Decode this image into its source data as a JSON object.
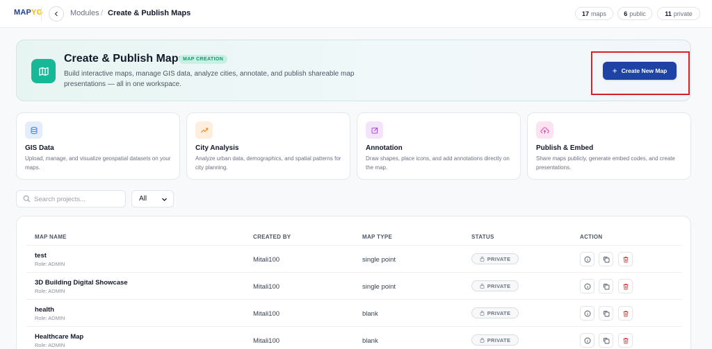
{
  "topbar": {
    "logo": "MAP",
    "logo_accent": "YG",
    "breadcrumb_root": "Modules",
    "breadcrumb_sep": "/",
    "breadcrumb_current": "Create & Publish Maps",
    "stats": [
      {
        "count": "17",
        "label": "maps"
      },
      {
        "count": "6",
        "label": "public"
      },
      {
        "count": "11",
        "label": "private"
      }
    ]
  },
  "hero": {
    "title": "Create & Publish Maps",
    "badge": "MAP CREATION",
    "description": "Build interactive maps, manage GIS data, analyze cities, annotate, and publish shareable map presentations — all in one workspace.",
    "create_button": "Create New Map"
  },
  "features": [
    {
      "title": "GIS Data",
      "desc": "Upload, manage, and visualize geospatial datasets on your maps.",
      "icon": "database-icon",
      "color": "#3b82f6",
      "bg": "#e5edfb"
    },
    {
      "title": "City Analysis",
      "desc": "Analyze urban data, demographics, and spatial patterns for city planning.",
      "icon": "trend-icon",
      "color": "#f08c2b",
      "bg": "#fdeedd"
    },
    {
      "title": "Annotation",
      "desc": "Draw shapes, place icons, and add annotations directly on the map.",
      "icon": "edit-icon",
      "color": "#a64bd6",
      "bg": "#f3e4fa"
    },
    {
      "title": "Publish & Embed",
      "desc": "Share maps publicly, generate embed codes, and create presentations.",
      "icon": "cloud-upload-icon",
      "color": "#d6459d",
      "bg": "#fbe3f1"
    }
  ],
  "filters": {
    "search_placeholder": "Search projects...",
    "select_value": "All"
  },
  "table": {
    "headers": [
      "MAP NAME",
      "CREATED BY",
      "MAP TYPE",
      "STATUS",
      "ACTION"
    ],
    "rows": [
      {
        "name": "test",
        "role": "Role: ADMIN",
        "created_by": "Mitali100",
        "type": "single point",
        "status": "PRIVATE"
      },
      {
        "name": "3D Building Digital Showcase",
        "role": "Role: ADMIN",
        "created_by": "Mitali100",
        "type": "single point",
        "status": "PRIVATE"
      },
      {
        "name": "health",
        "role": "Role: ADMIN",
        "created_by": "Mitali100",
        "type": "blank",
        "status": "PRIVATE"
      },
      {
        "name": "Healthcare Map",
        "role": "Role: ADMIN",
        "created_by": "Mitali100",
        "type": "blank",
        "status": "PRIVATE"
      }
    ]
  },
  "colors": {
    "accent": "#1e43a4",
    "hero_icon": "#17b897",
    "delete": "#e04848",
    "highlight": "#d51f26"
  }
}
